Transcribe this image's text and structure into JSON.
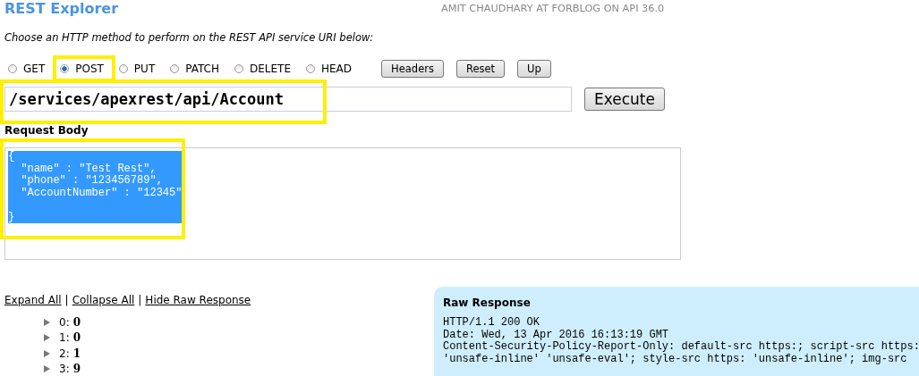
{
  "header": {
    "title": "REST Explorer",
    "user_info": "AMIT CHAUDHARY AT FORBLOG ON API 36.0"
  },
  "instructions": "Choose an HTTP method to perform on the REST API service URI below:",
  "methods": [
    {
      "label": "GET",
      "selected": false,
      "highlighted": false
    },
    {
      "label": "POST",
      "selected": true,
      "highlighted": true
    },
    {
      "label": "PUT",
      "selected": false,
      "highlighted": false
    },
    {
      "label": "PATCH",
      "selected": false,
      "highlighted": false
    },
    {
      "label": "DELETE",
      "selected": false,
      "highlighted": false
    },
    {
      "label": "HEAD",
      "selected": false,
      "highlighted": false
    }
  ],
  "toolbar_buttons": [
    "Headers",
    "Reset",
    "Up"
  ],
  "uri": {
    "value": "/services/apexrest/api/Account",
    "highlighted": true
  },
  "execute_button": "Execute",
  "request_body": {
    "label": "Request Body",
    "value": "{\n  \"name\" : \"Test Rest\",\n  \"phone\" : \"123456789\",\n  \"AccountNumber\" : \"12345\"\n\n}",
    "selected": true,
    "highlighted": true
  },
  "response_links": [
    "Expand All",
    "Collapse All",
    "Hide Raw Response"
  ],
  "separators": [
    "|",
    "|"
  ],
  "tree": [
    {
      "label": "0:",
      "value": "0"
    },
    {
      "label": "1:",
      "value": "0"
    },
    {
      "label": "2:",
      "value": "1"
    },
    {
      "label": "3:",
      "value": "9"
    }
  ],
  "raw_response": {
    "title": "Raw Response",
    "lines": [
      "HTTP/1.1 200 OK",
      "Date: Wed, 13 Apr 2016 16:13:19 GMT",
      "Content-Security-Policy-Report-Only: default-src https:; script-src https:",
      "'unsafe-inline' 'unsafe-eval'; style-src https: 'unsafe-inline'; img-src"
    ]
  }
}
